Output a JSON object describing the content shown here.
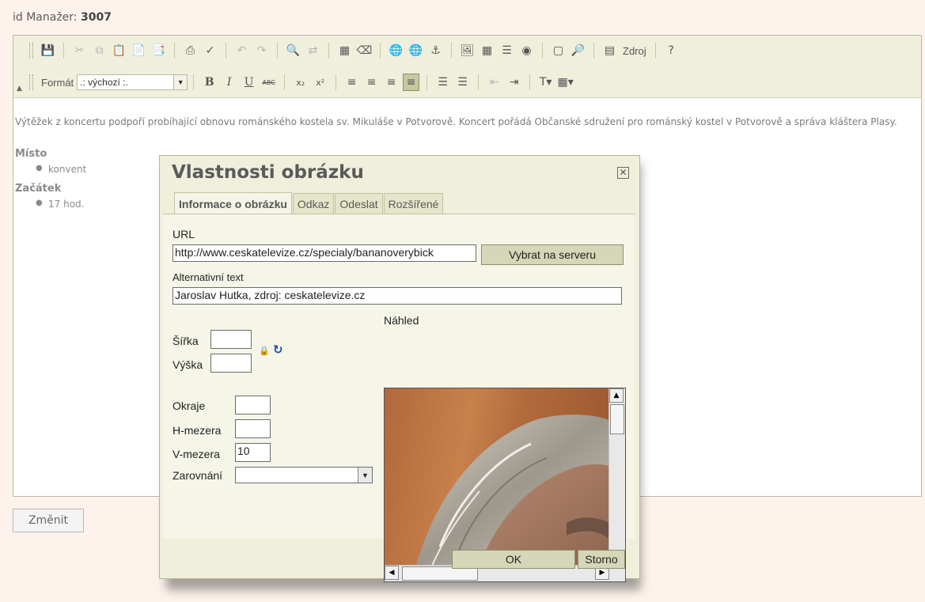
{
  "manager": {
    "label": "id Manažer:",
    "id": "3007"
  },
  "toolbar": {
    "format_label": "Formát",
    "format_value": ".: výchozí :.",
    "source_label": "Zdroj"
  },
  "content": {
    "paragraph": "Výtěžek z koncertu podpoří probíhající obnovu románského kostela sv. Mikuláše v Potvorově. Koncert pořádá Občanské sdružení pro románský kostel v Potvorově a správa kláštera Plasy.",
    "place_heading": "Místo",
    "place_value": "konvent",
    "start_heading": "Začátek",
    "start_value": "17 hod."
  },
  "change_button": "Změnit",
  "dialog": {
    "title": "Vlastnosti obrázku",
    "close_symbol": "✕",
    "tabs": [
      "Informace o obrázku",
      "Odkaz",
      "Odeslat",
      "Rozšířené"
    ],
    "url_label": "URL",
    "url_value": "http://www.ceskatelevize.cz/specialy/bananoverybick",
    "browse_button": "Vybrat na serveru",
    "alt_label": "Alternativní text",
    "alt_value": "Jaroslav Hutka, zdroj: ceskatelevize.cz",
    "preview_label": "Náhled",
    "width_label": "Šířka",
    "width_value": "",
    "height_label": "Výška",
    "height_value": "",
    "border_label": "Okraje",
    "border_value": "",
    "hspace_label": "H-mezera",
    "hspace_value": "",
    "vspace_label": "V-mezera",
    "vspace_value": "10",
    "align_label": "Zarovnání",
    "align_value": "",
    "ok_button": "OK",
    "cancel_button": "Storno"
  },
  "colors": {
    "page_background": "#fdf3ec",
    "dialog_background": "#efefdc",
    "toolbar_background": "#efefdc",
    "button_background": "#d6d6b8"
  },
  "icons": {
    "toolbar_row1": [
      "save-icon",
      "cut-icon",
      "copy-icon",
      "paste-icon",
      "paste-text-icon",
      "paste-word-icon",
      "print-icon",
      "spellcheck-icon",
      "undo-icon",
      "redo-icon",
      "find-icon",
      "replace-icon",
      "select-all-icon",
      "remove-format-icon",
      "link-icon",
      "unlink-icon",
      "anchor-icon",
      "image-icon",
      "table-icon",
      "horizontal-rule-icon",
      "smiley-icon",
      "show-blocks-icon",
      "preview-icon",
      "source-icon",
      "help-icon"
    ],
    "toolbar_row2": [
      "bold-icon",
      "italic-icon",
      "underline-icon",
      "strikethrough-icon",
      "subscript-icon",
      "superscript-icon",
      "align-left-icon",
      "align-center-icon",
      "align-right-icon",
      "justify-icon",
      "ordered-list-icon",
      "unordered-list-icon",
      "outdent-icon",
      "indent-icon",
      "text-color-icon",
      "background-color-icon"
    ]
  }
}
